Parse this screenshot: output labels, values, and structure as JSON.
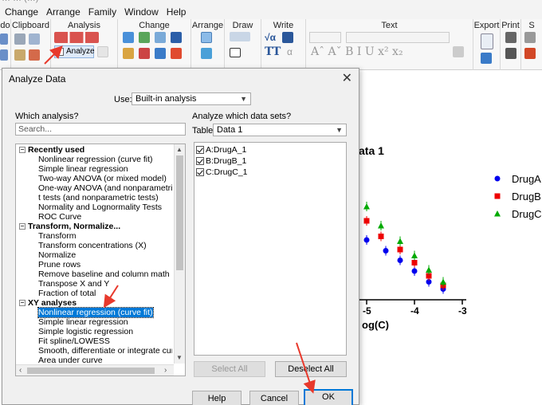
{
  "app": {
    "title_fragment": "… … (…)",
    "menu": [
      "Change",
      "Arrange",
      "Family",
      "Window",
      "Help"
    ]
  },
  "ribbon": {
    "groups": [
      {
        "id": "undo",
        "label": "do"
      },
      {
        "id": "clipboard",
        "label": "Clipboard"
      },
      {
        "id": "analysis",
        "label": "Analysis"
      },
      {
        "id": "change",
        "label": "Change"
      },
      {
        "id": "arrange",
        "label": "Arrange"
      },
      {
        "id": "draw",
        "label": "Draw"
      },
      {
        "id": "write",
        "label": "Write"
      },
      {
        "id": "text",
        "label": "Text"
      },
      {
        "id": "export",
        "label": "Export"
      },
      {
        "id": "print",
        "label": "Print"
      },
      {
        "id": "send",
        "label": "S"
      }
    ],
    "analyze_label": "Analyze",
    "text_tools": "Aˆ Aˇ B I U x² x₂"
  },
  "dialog": {
    "title": "Analyze Data",
    "use_label": "Use:",
    "use_value": "Built-in analysis",
    "which_analysis_label": "Which analysis?",
    "search_placeholder": "Search...",
    "analysis_tree": [
      {
        "text": "Recently used",
        "level": 0,
        "header": true
      },
      {
        "text": "Nonlinear regression (curve fit)",
        "level": 1
      },
      {
        "text": "Simple linear regression",
        "level": 1
      },
      {
        "text": "Two-way ANOVA (or mixed model)",
        "level": 1
      },
      {
        "text": "One-way ANOVA (and nonparametric or mi",
        "level": 1
      },
      {
        "text": "t tests (and nonparametric tests)",
        "level": 1
      },
      {
        "text": "Normality and Lognormality Tests",
        "level": 1
      },
      {
        "text": "ROC Curve",
        "level": 1
      },
      {
        "text": "Transform, Normalize...",
        "level": 0,
        "header": true
      },
      {
        "text": "Transform",
        "level": 1
      },
      {
        "text": "Transform concentrations (X)",
        "level": 1
      },
      {
        "text": "Normalize",
        "level": 1
      },
      {
        "text": "Prune rows",
        "level": 1
      },
      {
        "text": "Remove baseline and column math",
        "level": 1
      },
      {
        "text": "Transpose X and Y",
        "level": 1
      },
      {
        "text": "Fraction of total",
        "level": 1
      },
      {
        "text": "XY analyses",
        "level": 0,
        "header": true
      },
      {
        "text": "Nonlinear regression (curve fit)",
        "level": 1,
        "selected": true
      },
      {
        "text": "Simple linear regression",
        "level": 1
      },
      {
        "text": "Simple logistic regression",
        "level": 1
      },
      {
        "text": "Fit spline/LOWESS",
        "level": 1
      },
      {
        "text": "Smooth, differentiate or integrate curve",
        "level": 1
      },
      {
        "text": "Area under curve",
        "level": 1
      }
    ],
    "datasets_label": "Analyze which data sets?",
    "table_label": "Table:",
    "table_value": "Data 1",
    "datasets": [
      {
        "text": "A:DrugA_1",
        "checked": true
      },
      {
        "text": "B:DrugB_1",
        "checked": true
      },
      {
        "text": "C:DrugC_1",
        "checked": true
      }
    ],
    "select_all": "Select All",
    "deselect_all": "Deselect All",
    "help": "Help",
    "cancel": "Cancel",
    "ok": "OK"
  },
  "graph": {
    "title_fragment": "ata 1",
    "x_ticks": [
      "-5",
      "-4",
      "-3"
    ],
    "x_label_fragment": "og(C)",
    "legend": [
      {
        "name": "DrugA",
        "color": "#0000ee",
        "shape": "circle"
      },
      {
        "name": "DrugB",
        "color": "#ee0000",
        "shape": "square"
      },
      {
        "name": "DrugC",
        "color": "#00aa00",
        "shape": "triangle"
      }
    ]
  },
  "chart_data": {
    "type": "scatter",
    "x_ticks": [
      -5,
      -4,
      -3
    ],
    "series": [
      {
        "name": "DrugA",
        "x": [
          -5.0,
          -4.6,
          -4.3,
          -4.0,
          -3.7,
          -3.4
        ],
        "y": [
          0.5,
          0.41,
          0.33,
          0.24,
          0.15,
          0.09
        ]
      },
      {
        "name": "DrugB",
        "x": [
          -5.0,
          -4.7,
          -4.3,
          -4.0,
          -3.7,
          -3.4
        ],
        "y": [
          0.66,
          0.53,
          0.42,
          0.31,
          0.2,
          0.12
        ]
      },
      {
        "name": "DrugC",
        "x": [
          -5.0,
          -4.7,
          -4.3,
          -4.0,
          -3.7,
          -3.4
        ],
        "y": [
          0.78,
          0.62,
          0.49,
          0.37,
          0.25,
          0.15
        ]
      }
    ]
  },
  "colors": {
    "accent": "#0078d7",
    "arrow": "#e8392c"
  }
}
